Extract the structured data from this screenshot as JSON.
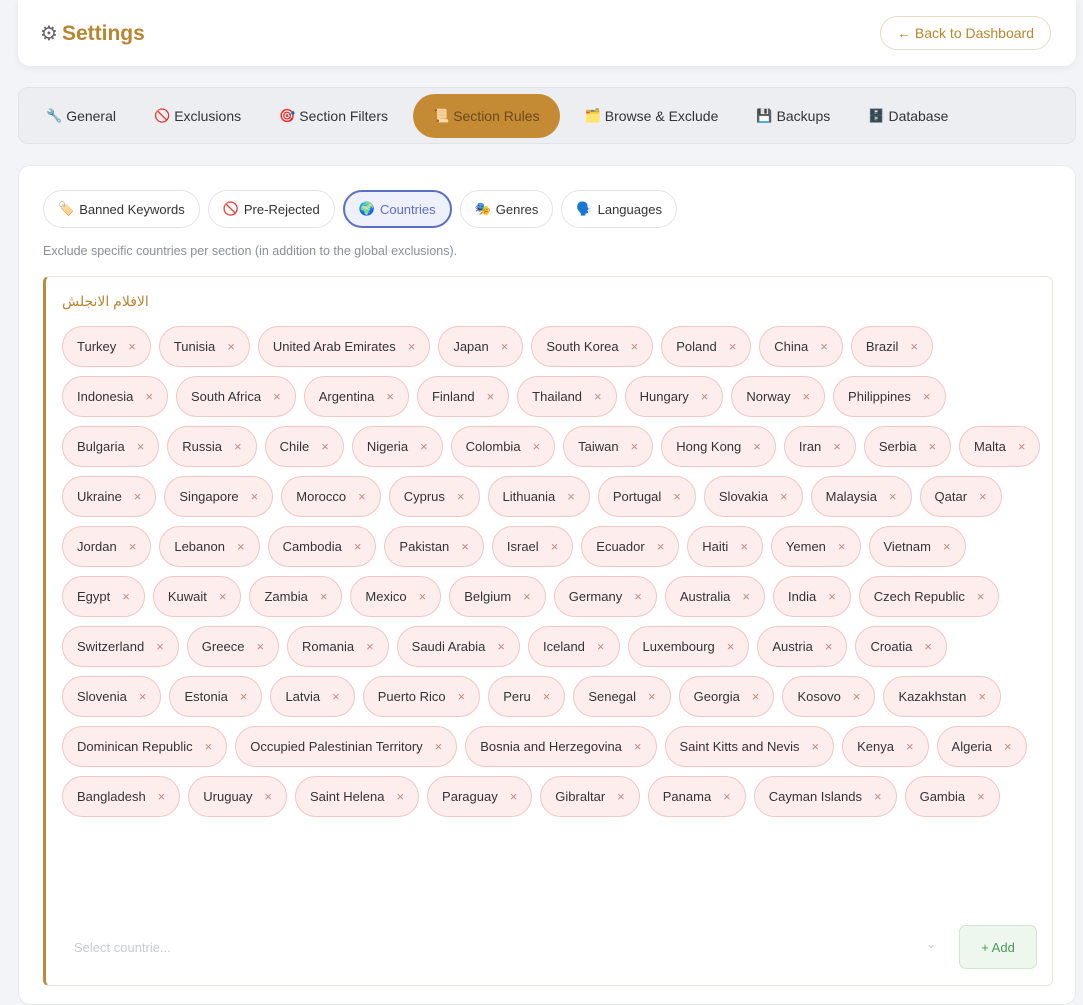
{
  "header": {
    "title": "Settings",
    "icon": "gear-icon",
    "back_label": "← Back to Dashboard"
  },
  "tabs": [
    {
      "icon": "🔧",
      "label": "General"
    },
    {
      "icon": "🚫",
      "label": "Exclusions"
    },
    {
      "icon": "🎯",
      "label": "Section Filters"
    },
    {
      "icon": "📜",
      "label": "Section Rules"
    },
    {
      "icon": "🗂️",
      "label": "Browse & Exclude"
    },
    {
      "icon": "💾",
      "label": "Backups"
    },
    {
      "icon": "🗄️",
      "label": "Database"
    }
  ],
  "subtabs": [
    {
      "icon": "🏷️",
      "label": "Banned Keywords"
    },
    {
      "icon": "🚫",
      "label": "Pre-Rejected"
    },
    {
      "icon": "🌍",
      "label": "Countries"
    },
    {
      "icon": "🎭",
      "label": "Genres"
    },
    {
      "icon": "🗣️",
      "label": "Languages"
    }
  ],
  "description": "Exclude specific countries per section (in addition to the global exclusions).",
  "section": {
    "name": "الافلام الانجلش",
    "countries": [
      "Turkey",
      "Tunisia",
      "United Arab Emirates",
      "Japan",
      "South Korea",
      "Poland",
      "China",
      "Brazil",
      "Indonesia",
      "South Africa",
      "Argentina",
      "Finland",
      "Thailand",
      "Hungary",
      "Norway",
      "Philippines",
      "Bulgaria",
      "Russia",
      "Chile",
      "Nigeria",
      "Colombia",
      "Taiwan",
      "Hong Kong",
      "Iran",
      "Serbia",
      "Malta",
      "Ukraine",
      "Singapore",
      "Morocco",
      "Cyprus",
      "Lithuania",
      "Portugal",
      "Slovakia",
      "Malaysia",
      "Qatar",
      "Jordan",
      "Lebanon",
      "Cambodia",
      "Pakistan",
      "Israel",
      "Ecuador",
      "Haiti",
      "Yemen",
      "Vietnam",
      "Egypt",
      "Kuwait",
      "Zambia",
      "Mexico",
      "Belgium",
      "Germany",
      "Australia",
      "India",
      "Czech Republic",
      "Switzerland",
      "Greece",
      "Romania",
      "Saudi Arabia",
      "Iceland",
      "Luxembourg",
      "Austria",
      "Croatia",
      "Slovenia",
      "Estonia",
      "Latvia",
      "Puerto Rico",
      "Peru",
      "Senegal",
      "Georgia",
      "Kosovo",
      "Kazakhstan",
      "Dominican Republic",
      "Occupied Palestinian Territory",
      "Bosnia and Herzegovina",
      "Saint Kitts and Nevis",
      "Kenya",
      "Algeria",
      "Bangladesh",
      "Uruguay",
      "Saint Helena",
      "Paraguay",
      "Gibraltar",
      "Panama",
      "Cayman Islands",
      "Gambia"
    ],
    "remove_glyph": "×",
    "select_placeholder": "Select countrie...",
    "add_label": "+ Add"
  },
  "active_tab_index": 3,
  "active_subtab_index": 2,
  "colors": {
    "accent": "#c48a34",
    "active_subtab": "#5a6fc4",
    "chip_bg": "#fdeeed",
    "add_green": "#4a9a5a"
  }
}
